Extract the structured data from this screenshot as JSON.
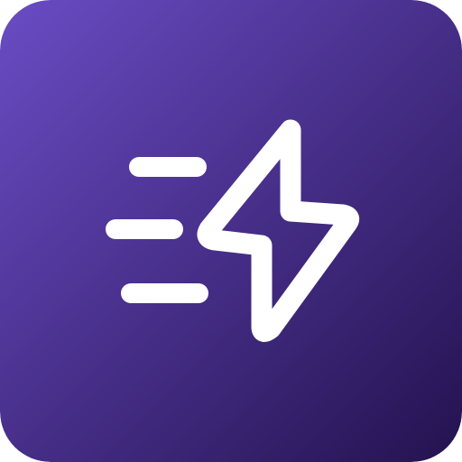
{
  "icon": {
    "name": "fast-lightning-app-icon",
    "symbol": "lightning-bolt-with-speed-lines",
    "colors": {
      "gradient_start": "#6a4cc4",
      "gradient_end": "#24124f",
      "glyph": "#ffffff"
    }
  }
}
